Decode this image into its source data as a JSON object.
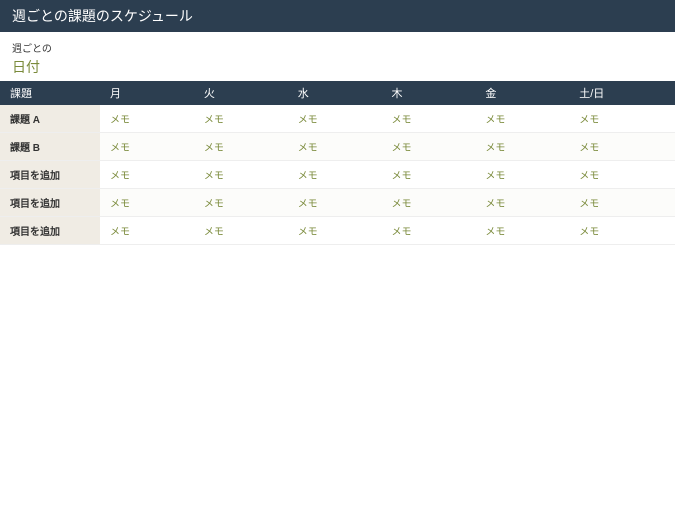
{
  "header": {
    "title": "週ごとの課題のスケジュール"
  },
  "subheader": {
    "week_label": "週ごとの",
    "date_label": "日付"
  },
  "table": {
    "columns": [
      "課題",
      "月",
      "火",
      "水",
      "木",
      "金",
      "土/日"
    ],
    "rows": [
      {
        "label": "課題 A",
        "cells": [
          "メモ",
          "メモ",
          "メモ",
          "メモ",
          "メモ",
          "メモ"
        ]
      },
      {
        "label": "課題 B",
        "cells": [
          "メモ",
          "メモ",
          "メモ",
          "メモ",
          "メモ",
          "メモ"
        ]
      },
      {
        "label": "項目を追加",
        "cells": [
          "メモ",
          "メモ",
          "メモ",
          "メモ",
          "メモ",
          "メモ"
        ]
      },
      {
        "label": "項目を追加",
        "cells": [
          "メモ",
          "メモ",
          "メモ",
          "メモ",
          "メモ",
          "メモ"
        ]
      },
      {
        "label": "項目を追加",
        "cells": [
          "メモ",
          "メモ",
          "メモ",
          "メモ",
          "メモ",
          "メモ"
        ]
      }
    ]
  }
}
